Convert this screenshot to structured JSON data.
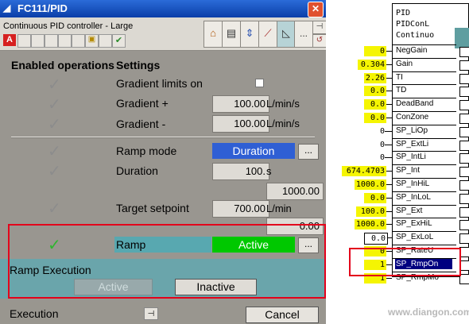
{
  "window": {
    "title": "FC111/PID",
    "close_glyph": "✕"
  },
  "toolbar": {
    "subtitle": "Continuous PID controller - Large",
    "alarm_letter": "A",
    "ellipsis_label": "..."
  },
  "headers": {
    "enabled_ops": "Enabled operations",
    "settings": "Settings"
  },
  "rows": {
    "gradient_limits_on": {
      "label": "Gradient limits on"
    },
    "gradient_plus": {
      "label": "Gradient +",
      "value": "100.00",
      "unit": "L/min/s"
    },
    "gradient_minus": {
      "label": "Gradient -",
      "value": "100.00",
      "unit": "L/min/s"
    },
    "ramp_mode": {
      "label": "Ramp mode",
      "value": "Duration",
      "button": "..."
    },
    "duration": {
      "label": "Duration",
      "value": "100.",
      "unit": "s",
      "value2": "1000.00"
    },
    "target_setpoint": {
      "label": "Target setpoint",
      "value": "700.00",
      "unit": "L/min",
      "value2": "0.00"
    },
    "ramp": {
      "label": "Ramp",
      "value": "Active",
      "button": "..."
    }
  },
  "ramp_execution": {
    "title": "Ramp Execution",
    "active_label": "Active",
    "inactive_label": "Inactive"
  },
  "footer": {
    "execution_label": "Execution",
    "cancel_label": "Cancel"
  },
  "block": {
    "header": [
      "PID",
      "PIDConL",
      "Continuo"
    ],
    "pins": [
      {
        "name": "NegGain",
        "value": "0"
      },
      {
        "name": "Gain",
        "value": "0.304"
      },
      {
        "name": "TI",
        "value": "2.26"
      },
      {
        "name": "TD",
        "value": "0.0"
      },
      {
        "name": "DeadBand",
        "value": "0.0"
      },
      {
        "name": "ConZone",
        "value": "0.0"
      },
      {
        "name": "SP_LiOp",
        "value": "0"
      },
      {
        "name": "SP_ExtLi",
        "value": "0"
      },
      {
        "name": "SP_IntLi",
        "value": "0"
      },
      {
        "name": "SP_Int",
        "value": "674.4703"
      },
      {
        "name": "SP_InHiL",
        "value": "1000.0"
      },
      {
        "name": "SP_InLoL",
        "value": "0.0"
      },
      {
        "name": "SP_Ext",
        "value": "100.0"
      },
      {
        "name": "SP_ExHiL",
        "value": "1000.0"
      },
      {
        "name": "SP_ExLoL",
        "value": "0.0"
      },
      {
        "name": "SP_RateU",
        "value": "0"
      },
      {
        "name": "SP_RmpOn",
        "value": "1"
      },
      {
        "name": "SP_RmpMo",
        "value": "1"
      }
    ]
  },
  "watermark": "www.diangon.com",
  "colors": {
    "active_green": "#00c800",
    "duration_blue": "#2f5fd4",
    "highlight_red": "#e3001b",
    "pin_yellow": "#f5f502",
    "teal": "#6aa5ab"
  }
}
